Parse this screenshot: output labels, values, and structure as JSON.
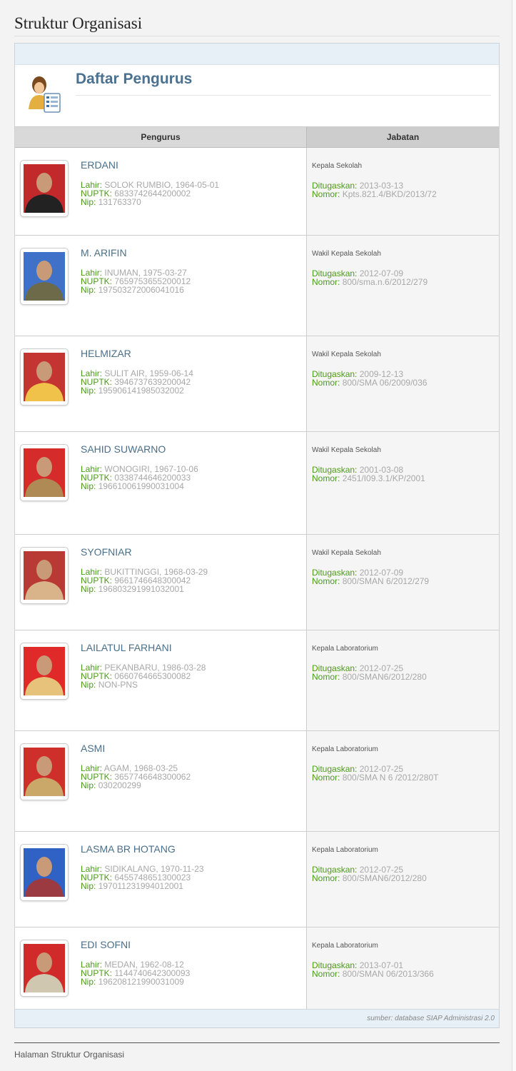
{
  "page": {
    "title": "Struktur Organisasi",
    "footer_text": "Halaman Struktur Organisasi"
  },
  "panel": {
    "heading": "Daftar Pengurus",
    "col_pengurus": "Pengurus",
    "col_jabatan": "Jabatan",
    "source": "sumber: database SIAP Administrasi 2.0"
  },
  "labels": {
    "lahir": "Lahir:",
    "nuptk": "NUPTK:",
    "nip": "Nip:",
    "ditugaskan": "Ditugaskan:",
    "nomor": "Nomor:"
  },
  "staff": [
    {
      "name": "ERDANI",
      "lahir": "SOLOK RUMBIO, 1964-05-01",
      "nuptk": "6833742644200002",
      "nip": "131763370",
      "jabatan": "Kepala Sekolah",
      "ditugaskan": "2013-03-13",
      "nomor": "Kpts.821.4/BKD/2013/72",
      "bg": "#c1292b",
      "shirt": "#222"
    },
    {
      "name": "M. ARIFIN",
      "lahir": "INUMAN, 1975-03-27",
      "nuptk": "7659753655200012",
      "nip": "197503272006041016",
      "jabatan": "Wakil Kepala Sekolah",
      "ditugaskan": "2012-07-09",
      "nomor": "800/sma.n.6/2012/279",
      "bg": "#3f71c8",
      "shirt": "#6d6a4a"
    },
    {
      "name": "HELMIZAR",
      "lahir": "SULIT AIR, 1959-06-14",
      "nuptk": "3946737639200042",
      "nip": "195906141985032002",
      "jabatan": "Wakil Kepala Sekolah",
      "ditugaskan": "2009-12-13",
      "nomor": "800/SMA 06/2009/036",
      "bg": "#c43430",
      "shirt": "#f0c24a"
    },
    {
      "name": "SAHID SUWARNO",
      "lahir": "WONOGIRI, 1967-10-06",
      "nuptk": "0338744646200033",
      "nip": "196610061990031004",
      "jabatan": "Wakil Kepala Sekolah",
      "ditugaskan": "2001-03-08",
      "nomor": "2451/I09.3.1/KP/2001",
      "bg": "#d62b2b",
      "shirt": "#b08a55"
    },
    {
      "name": "SYOFNIAR",
      "lahir": "BUKITTINGGI, 1968-03-29",
      "nuptk": "9661746648300042",
      "nip": "196803291991032001",
      "jabatan": "Wakil Kepala Sekolah",
      "ditugaskan": "2012-07-09",
      "nomor": "800/SMAN 6/2012/279",
      "bg": "#b93a34",
      "shirt": "#d9b48a"
    },
    {
      "name": "LAILATUL FARHANI",
      "lahir": "PEKANBARU, 1986-03-28",
      "nuptk": "0660764665300082",
      "nip": "NON-PNS",
      "jabatan": "Kepala Laboratorium",
      "ditugaskan": "2012-07-25",
      "nomor": "800/SMAN6/2012/280",
      "bg": "#e02a2a",
      "shirt": "#e6c27a"
    },
    {
      "name": "ASMI",
      "lahir": "AGAM, 1968-03-25",
      "nuptk": "3657746648300062",
      "nip": "030200299",
      "jabatan": "Kepala Laboratorium",
      "ditugaskan": "2012-07-25",
      "nomor": "800/SMA N 6 /2012/280T",
      "bg": "#cf2f2b",
      "shirt": "#c9a86a"
    },
    {
      "name": "LASMA BR HOTANG",
      "lahir": "SIDIKALANG, 1970-11-23",
      "nuptk": "6455748651300023",
      "nip": "197011231994012001",
      "jabatan": "Kepala Laboratorium",
      "ditugaskan": "2012-07-25",
      "nomor": "800/SMAN6/2012/280",
      "bg": "#2f62c4",
      "shirt": "#9c3a42"
    },
    {
      "name": "EDI SOFNI",
      "lahir": "MEDAN, 1962-08-12",
      "nuptk": "1144740642300093",
      "nip": "196208121990031009",
      "jabatan": "Kepala Laboratorium",
      "ditugaskan": "2013-07-01",
      "nomor": "800/SMAN 06/2013/366",
      "bg": "#d12a2a",
      "shirt": "#cfc7b0"
    }
  ]
}
